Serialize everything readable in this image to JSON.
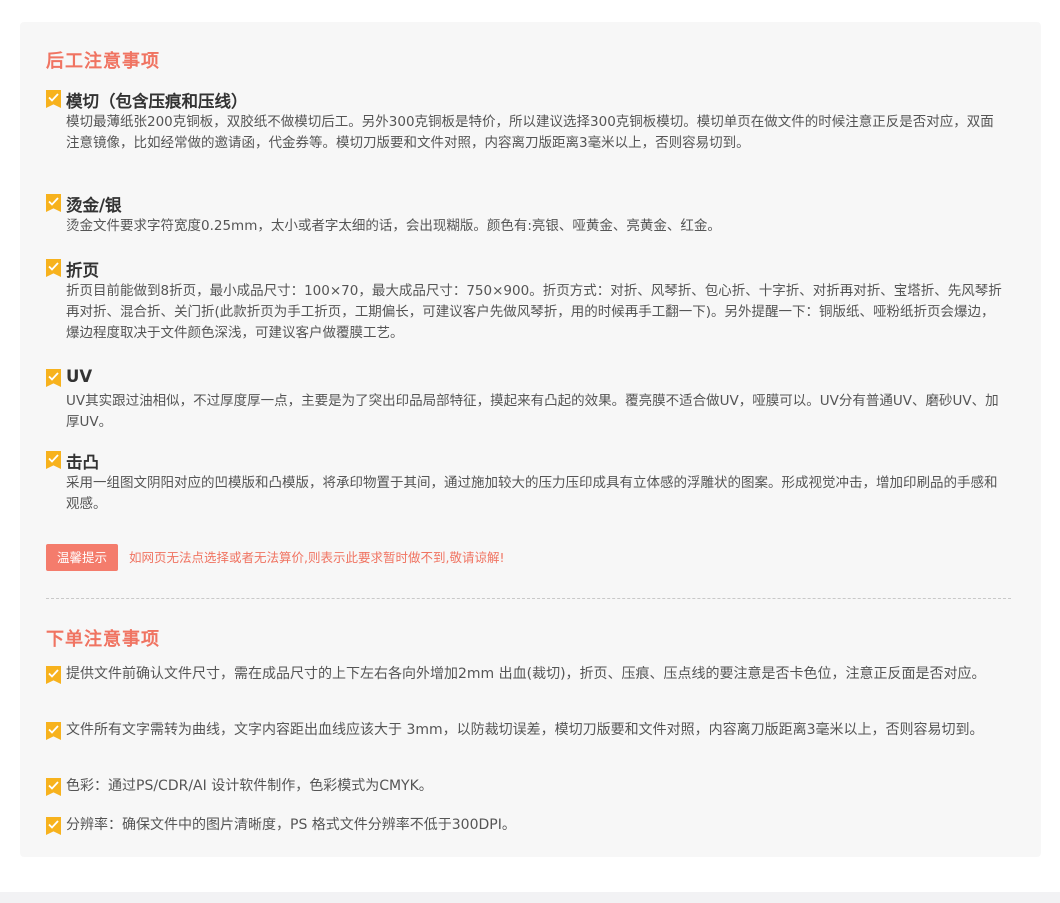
{
  "post_process": {
    "title": "后工注意事项",
    "items": [
      {
        "title": "模切（包含压痕和压线）",
        "desc": "模切最薄纸张200克铜板，双胶纸不做模切后工。另外300克铜板是特价，所以建议选择300克铜板模切。模切单页在做文件的时候注意正反是否对应，双面注意镜像，比如经常做的邀请函，代金券等。模切刀版要和文件对照，内容离刀版距离3毫米以上，否则容易切到。"
      },
      {
        "title": "烫金/银",
        "desc": "烫金文件要求字符宽度0.25mm，太小或者字太细的话，会出现糊版。颜色有:亮银、哑黄金、亮黄金、红金。"
      },
      {
        "title": "折页",
        "desc": "折页目前能做到8折页，最小成品尺寸：100×70，最大成品尺寸：750×900。折页方式：对折、风琴折、包心折、十字折、对折再对折、宝塔折、先风琴折再对折、混合折、关门折(此款折页为手工折页，工期偏长，可建议客户先做风琴折，用的时候再手工翻一下)。另外提醒一下：铜版纸、哑粉纸折页会爆边，爆边程度取决于文件颜色深浅，可建议客户做覆膜工艺。"
      },
      {
        "title": "UV",
        "desc": "UV其实跟过油相似，不过厚度厚一点，主要是为了突出印品局部特征，摸起来有凸起的效果。覆亮膜不适合做UV，哑膜可以。UV分有普通UV、磨砂UV、加厚UV。"
      },
      {
        "title": "击凸",
        "desc": "采用一组图文阴阳对应的凹模版和凸模版，将承印物置于其间，通过施加较大的压力压印成具有立体感的浮雕状的图案。形成视觉冲击，增加印刷品的手感和观感。"
      }
    ]
  },
  "tip": {
    "badge": "温馨提示",
    "text": "如网页无法点选择或者无法算价,则表示此要求暂时做不到,敬请谅解!"
  },
  "order_notes": {
    "title": "下单注意事项",
    "items": [
      "提供文件前确认文件尺寸，需在成品尺寸的上下左右各向外增加2mm 出血(裁切)，折页、压痕、压点线的要注意是否卡色位，注意正反面是否对应。",
      "文件所有文字需转为曲线，文字内容距出血线应该大于 3mm，以防裁切误差，模切刀版要和文件对照，内容离刀版距离3毫米以上，否则容易切到。",
      "色彩：通过PS/CDR/AI 设计软件制作，色彩模式为CMYK。",
      "分辨率：确保文件中的图片清晰度，PS 格式文件分辨率不低于300DPI。"
    ]
  },
  "colors": {
    "accent": "#f07462",
    "check": "#f7b21d",
    "panel_bg": "#f7f7f7"
  },
  "icons": {
    "check": "check-badge-icon"
  }
}
